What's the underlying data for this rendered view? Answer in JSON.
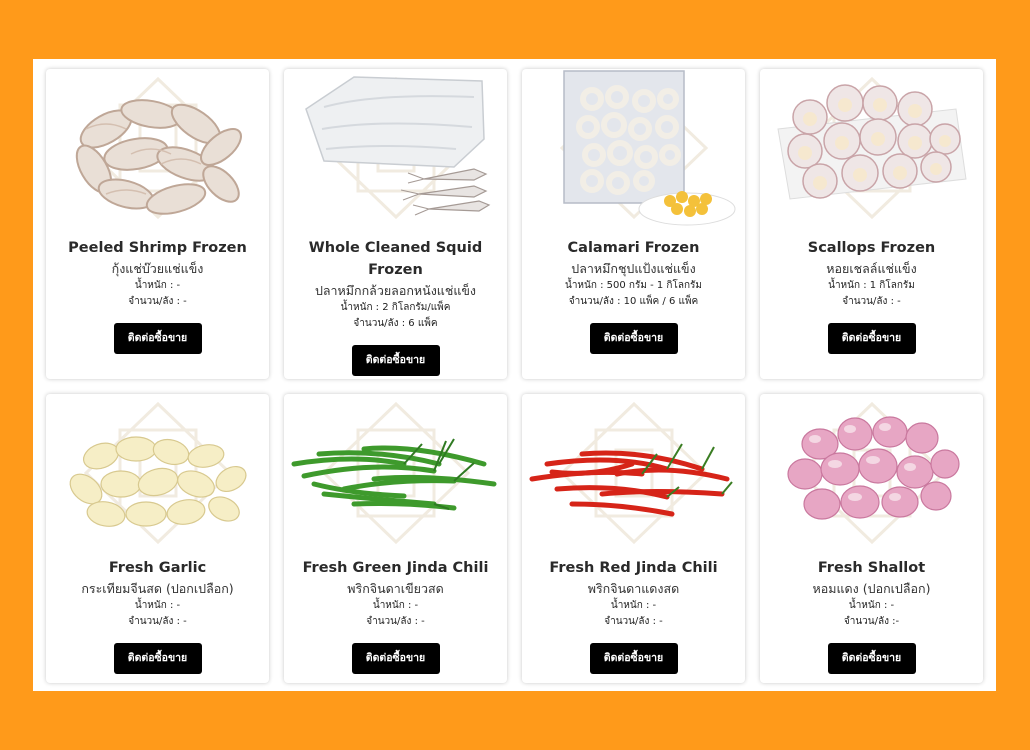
{
  "products": [
    {
      "name": "Peeled Shrimp Frozen",
      "thai": "กุ้งแช่บ๊วยแช่แข็ง",
      "weight": "น้ำหนัก : -",
      "qty": "จำนวน/ลัง : -",
      "button": "ติดต่อซื้อขาย",
      "image_icon": "shrimp-image"
    },
    {
      "name": "Whole Cleaned Squid Frozen",
      "thai": "ปลาหมึกกล้วยลอกหนังแช่แข็ง",
      "weight": "น้ำหนัก : 2 กิโลกรัม/แพ็ค",
      "qty": "จำนวน/ลัง : 6 แพ็ค",
      "button": "ติดต่อซื้อขาย",
      "image_icon": "squid-image"
    },
    {
      "name": "Calamari Frozen",
      "thai": "ปลาหมึกชุปแป้งแช่แข็ง",
      "weight": "น้ำหนัก : 500 กรัม - 1 กิโลกรัม",
      "qty": "จำนวน/ลัง : 10 แพ็ค / 6 แพ็ค",
      "button": "ติดต่อซื้อขาย",
      "image_icon": "calamari-image"
    },
    {
      "name": "Scallops Frozen",
      "thai": "หอยเชลล์แช่แข็ง",
      "weight": "น้ำหนัก : 1 กิโลกรัม",
      "qty": "จำนวน/ลัง : -",
      "button": "ติดต่อซื้อขาย",
      "image_icon": "scallops-image"
    },
    {
      "name": "Fresh Garlic",
      "thai": "กระเทียมจีนสด (ปอกเปลือก)",
      "weight": "น้ำหนัก : -",
      "qty": "จำนวน/ลัง : -",
      "button": "ติดต่อซื้อขาย",
      "image_icon": "garlic-image"
    },
    {
      "name": "Fresh Green Jinda Chili",
      "thai": "พริกจินดาเขียวสด",
      "weight": "น้ำหนัก : -",
      "qty": "จำนวน/ลัง : -",
      "button": "ติดต่อซื้อขาย",
      "image_icon": "green-chili-image"
    },
    {
      "name": "Fresh Red Jinda Chili",
      "thai": "พริกจินดาแดงสด",
      "weight": "น้ำหนัก : -",
      "qty": "จำนวน/ลัง : -",
      "button": "ติดต่อซื้อขาย",
      "image_icon": "red-chili-image"
    },
    {
      "name": "Fresh Shallot",
      "thai": "หอมแดง (ปอกเปลือก)",
      "weight": "น้ำหนัก : -",
      "qty": "จำนวน/ลัง :-",
      "button": "ติดต่อซื้อขาย",
      "image_icon": "shallot-image"
    }
  ],
  "colors": {
    "background": "#ff9a1a",
    "button": "#000000",
    "panel": "#ffffff"
  }
}
